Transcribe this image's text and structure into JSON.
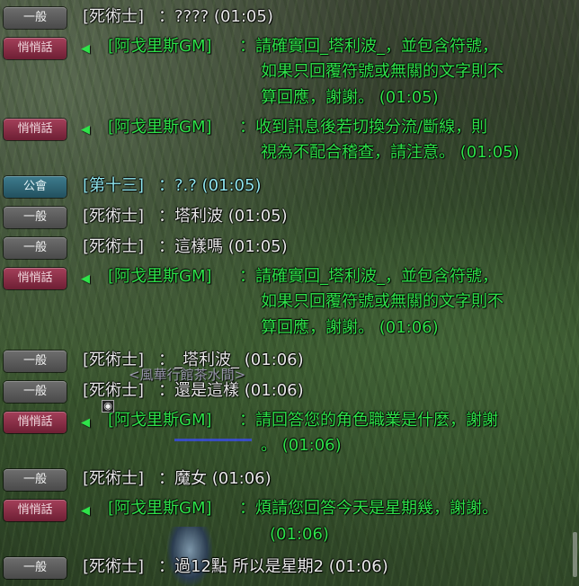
{
  "badges": {
    "normal": "一般",
    "whisper": "悄悄話",
    "guild": "公會"
  },
  "arrow_glyph": "◀",
  "messages": [
    {
      "sender": "[死術士]",
      "text": "：???? (01:05)"
    },
    {
      "sender": "[阿戈里斯GM]",
      "lines": [
        "：請確實回_塔利波_，並包含符號，",
        "如果只回覆符號或無關的文字則不",
        "算回應，謝謝。 (01:05)"
      ]
    },
    {
      "sender": "[阿戈里斯GM]",
      "lines": [
        "：收到訊息後若切換分流/斷線，則",
        "視為不配合稽查，請注意。 (01:05)"
      ]
    },
    {
      "sender": "[第十三]",
      "text": "：?.? (01:05)"
    },
    {
      "sender": "[死術士]",
      "text": "：塔利波 (01:05)"
    },
    {
      "sender": "[死術士]",
      "text": "：這樣嗎 (01:05)"
    },
    {
      "sender": "[阿戈里斯GM]",
      "lines": [
        "：請確實回_塔利波_，並包含符號，",
        "如果只回覆符號或無關的文字則不",
        "算回應，謝謝。 (01:06)"
      ]
    },
    {
      "sender": "[死術士]",
      "text": "：_塔利波_ (01:06)"
    },
    {
      "sender": "[死術士]",
      "text": "：還是這樣 (01:06)"
    },
    {
      "sender": "[阿戈里斯GM]",
      "lines": [
        "：請回答您的角色職業是什麼，謝謝",
        "。 (01:06)"
      ]
    },
    {
      "sender": "[死術士]",
      "text": "：魔女 (01:06)"
    },
    {
      "sender": "[阿戈里斯GM]",
      "lines": [
        "：煩請您回答今天是星期幾，謝謝。",
        "(01:06)"
      ]
    },
    {
      "sender": "[死術士]",
      "text": "：過12點 所以是星期2 (01:06)"
    }
  ],
  "world": {
    "guild_overlay": "<風華行館茶水間>"
  }
}
